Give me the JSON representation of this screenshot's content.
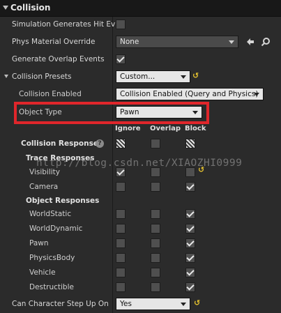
{
  "section": {
    "title": "Collision"
  },
  "rows": {
    "sim_hit": {
      "label": "Simulation Generates Hit Ev",
      "checked": false
    },
    "phys_material": {
      "label": "Phys Material Override",
      "value": "None"
    },
    "overlap": {
      "label": "Generate Overlap Events",
      "checked": true
    },
    "presets": {
      "label": "Collision Presets",
      "value": "Custom..."
    },
    "enabled": {
      "label": "Collision Enabled",
      "value": "Collision Enabled (Query and Physics)"
    },
    "object_type": {
      "label": "Object Type",
      "value": "Pawn"
    },
    "step_up": {
      "label": "Can Character Step Up On",
      "value": "Yes"
    }
  },
  "responses": {
    "columns": [
      "Ignore",
      "Overlap",
      "Block"
    ],
    "label": "Collision Responses",
    "trace_label": "Trace Responses",
    "object_label": "Object Responses",
    "all_state": [
      "mixed",
      "unchecked",
      "mixed"
    ],
    "trace": [
      {
        "name": "Visibility",
        "state": [
          "checked",
          "unchecked",
          "unchecked"
        ],
        "reset": true
      },
      {
        "name": "Camera",
        "state": [
          "unchecked",
          "unchecked",
          "checked"
        ],
        "reset": false
      }
    ],
    "object": [
      {
        "name": "WorldStatic",
        "state": [
          "unchecked",
          "unchecked",
          "checked"
        ]
      },
      {
        "name": "WorldDynamic",
        "state": [
          "unchecked",
          "unchecked",
          "checked"
        ]
      },
      {
        "name": "Pawn",
        "state": [
          "unchecked",
          "unchecked",
          "checked"
        ]
      },
      {
        "name": "PhysicsBody",
        "state": [
          "unchecked",
          "unchecked",
          "checked"
        ]
      },
      {
        "name": "Vehicle",
        "state": [
          "unchecked",
          "unchecked",
          "checked"
        ]
      },
      {
        "name": "Destructible",
        "state": [
          "unchecked",
          "unchecked",
          "checked"
        ]
      }
    ]
  },
  "reset_glyph": "↺",
  "watermark": "http://blog.csdn.net/XIAOZHI0999",
  "icons": {
    "browse": "arrow-left-icon",
    "search": "search-icon",
    "help": "help-icon"
  },
  "colors": {
    "highlight": "#e0262b",
    "reset": "#e5c22e"
  }
}
